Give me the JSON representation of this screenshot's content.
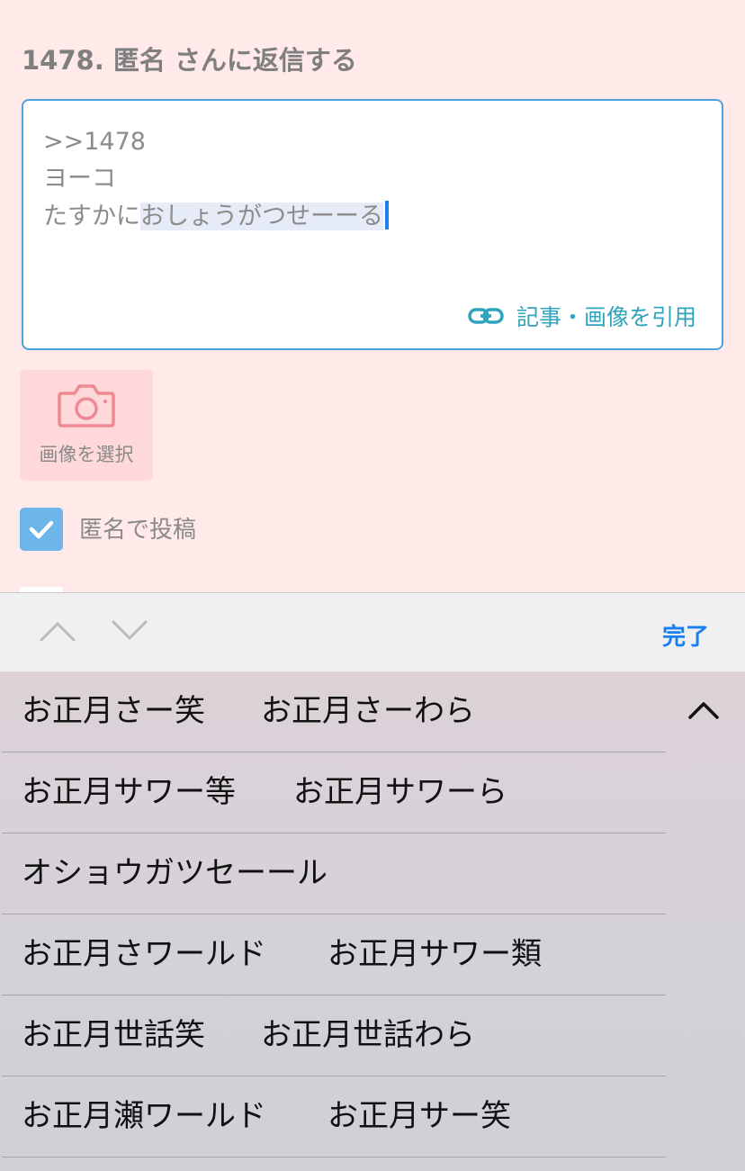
{
  "reply": {
    "title": "1478. 匿名 さんに返信する",
    "lines": [
      ">>1478",
      "ヨーコ"
    ],
    "line3_plain": "たすかに",
    "line3_marked": "おしょうがつせーーる",
    "quote_link_label": "記事・画像を引用"
  },
  "image_select": {
    "label": "画像を選択",
    "icon": "camera-icon"
  },
  "anonymous": {
    "label": "匿名で投稿",
    "checked": true
  },
  "accessory": {
    "done_label": "完了"
  },
  "candidates": [
    [
      "お正月さー笑",
      "お正月さーわら"
    ],
    [
      "お正月サワー等",
      "お正月サワーら"
    ],
    [
      "オショウガツセーール"
    ],
    [
      "お正月さワールド",
      "お正月サワー類"
    ],
    [
      "お正月世話笑",
      "お正月世話わら"
    ],
    [
      "お正月瀬ワールド",
      "お正月サー笑"
    ]
  ],
  "colors": {
    "page_bg": "#ffe9e9",
    "accent_blue": "#1a7ff0",
    "link_teal": "#2fa5bd",
    "checkbox_blue": "#6cb6ea",
    "camera_pink": "#f08a92"
  }
}
